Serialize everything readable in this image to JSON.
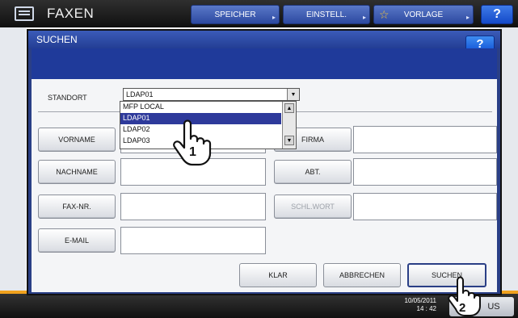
{
  "app": {
    "title": "FAXEN"
  },
  "toolbar": {
    "speicher_label": "SPEICHER",
    "einstell_label": "EINSTELL.",
    "vorlage_label": "VORLAGE",
    "help_label": "?"
  },
  "dialog": {
    "title": "SUCHEN",
    "help_label": "?",
    "location_label": "STANDORT",
    "location_value": "LDAP01",
    "location_options": [
      "MFP LOCAL",
      "LDAP01",
      "LDAP02",
      "LDAP03"
    ],
    "fields": {
      "vorname": "VORNAME",
      "nachname": "NACHNAME",
      "fax_nr": "FAX-NR.",
      "email": "E-MAIL",
      "firma": "FIRMA",
      "abt": "ABT.",
      "schl_wort": "SCHL.WORT"
    },
    "actions": {
      "klar": "KLAR",
      "abbrechen": "ABBRECHEN",
      "suchen": "SUCHEN"
    }
  },
  "status": {
    "date": "10/05/2011",
    "time": "14 : 42",
    "button_label": "US"
  },
  "callouts": [
    "1",
    "2"
  ],
  "colors": {
    "selected": "#2e3a9b",
    "accent": "#f1a21e"
  }
}
